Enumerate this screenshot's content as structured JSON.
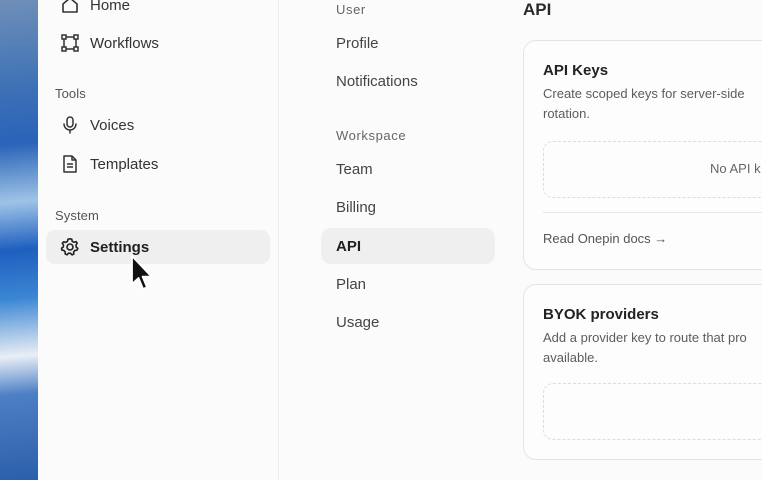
{
  "sidebar": {
    "items_top": [
      {
        "label": "Home",
        "icon": "home-icon"
      },
      {
        "label": "Workflows",
        "icon": "workflows-icon"
      }
    ],
    "tools_label": "Tools",
    "tools_items": [
      {
        "label": "Voices",
        "icon": "microphone-icon"
      },
      {
        "label": "Templates",
        "icon": "document-icon"
      }
    ],
    "system_label": "System",
    "system_items": [
      {
        "label": "Settings",
        "icon": "gear-icon",
        "active": true
      }
    ]
  },
  "settings_nav": {
    "user_label": "User",
    "user_items": [
      "Profile",
      "Notifications"
    ],
    "workspace_label": "Workspace",
    "workspace_items": [
      "Team",
      "Billing",
      "API",
      "Plan",
      "Usage"
    ],
    "active": "API"
  },
  "main": {
    "title": "API",
    "api_keys": {
      "title": "API Keys",
      "desc": "Create scoped keys for server-side rotation.",
      "empty": "No API k",
      "link": "Read Onepin docs →"
    },
    "byok": {
      "title": "BYOK providers",
      "desc": "Add a provider key to route that pro available."
    }
  },
  "colors": {
    "active_bg": "#efefef",
    "border": "#e4e4e4",
    "text": "#2b2b2b"
  }
}
